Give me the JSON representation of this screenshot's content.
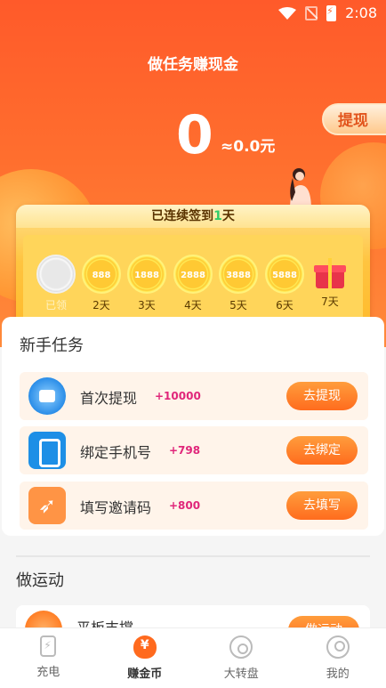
{
  "status": {
    "time": "2:08"
  },
  "header": {
    "title": "做任务赚现金",
    "withdraw_label": "提现",
    "balance": "0",
    "balance_rmb": "≈0.0元"
  },
  "checkin": {
    "text_prefix": "已连续签到",
    "days_count": "1",
    "text_suffix": "天",
    "days": [
      {
        "coin": "",
        "label": "已领",
        "done": true
      },
      {
        "coin": "888",
        "label": "2天"
      },
      {
        "coin": "1888",
        "label": "3天"
      },
      {
        "coin": "2888",
        "label": "4天"
      },
      {
        "coin": "3888",
        "label": "5天"
      },
      {
        "coin": "5888",
        "label": "6天"
      },
      {
        "coin": "gift-icon",
        "label": "7天"
      }
    ]
  },
  "newbie": {
    "title": "新手任务",
    "tasks": [
      {
        "name": "首次提现",
        "bonus": "+10000",
        "button": "去提现",
        "icon": "wallet-icon"
      },
      {
        "name": "绑定手机号",
        "bonus": "+798",
        "button": "去绑定",
        "icon": "phone-icon"
      },
      {
        "name": "填写邀请码",
        "bonus": "+800",
        "button": "去填写",
        "icon": "rocket-icon"
      }
    ]
  },
  "sports": {
    "title": "做运动",
    "row_name": "平板支撑",
    "row_button": "做运动"
  },
  "nav": {
    "items": [
      {
        "label": "充电",
        "icon": "charge-icon"
      },
      {
        "label": "赚金币",
        "icon": "coin-bag-icon",
        "active": true
      },
      {
        "label": "大转盘",
        "icon": "wheel-icon"
      },
      {
        "label": "我的",
        "icon": "profile-icon"
      }
    ]
  },
  "colors": {
    "accent": "#ff6a2e",
    "bonus": "#e0267a",
    "gold": "#ffc440"
  }
}
